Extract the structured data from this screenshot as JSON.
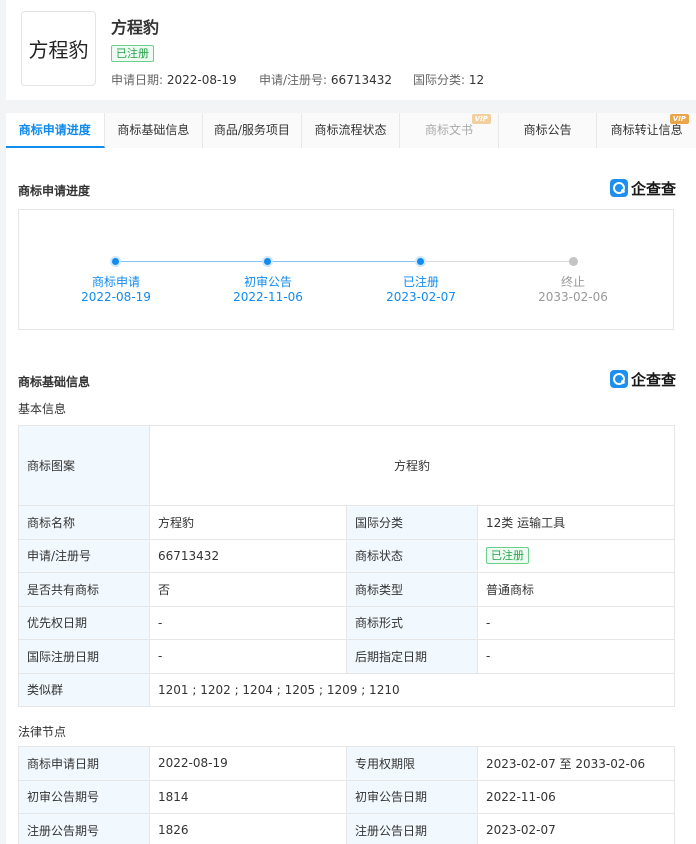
{
  "header": {
    "logo_text": "方程豹",
    "title": "方程豹",
    "status_badge": "已注册",
    "apply_date_label": "申请日期:",
    "apply_date": "2022-08-19",
    "reg_no_label": "申请/注册号:",
    "reg_no": "66713432",
    "intl_class_label": "国际分类:",
    "intl_class": "12"
  },
  "tabs": [
    {
      "label": "商标申请进度",
      "state": "active"
    },
    {
      "label": "商标基础信息",
      "state": "normal"
    },
    {
      "label": "商品/服务项目",
      "state": "normal"
    },
    {
      "label": "商标流程状态",
      "state": "normal"
    },
    {
      "label": "商标文书",
      "state": "disabled",
      "vip": "VIP"
    },
    {
      "label": "商标公告",
      "state": "normal"
    },
    {
      "label": "商标转让信息",
      "state": "normal",
      "vip": "VIP"
    }
  ],
  "progress": {
    "title": "商标申请进度",
    "brand": "企查查",
    "steps": [
      {
        "name": "商标申请",
        "date": "2022-08-19",
        "done": true
      },
      {
        "name": "初审公告",
        "date": "2022-11-06",
        "done": true
      },
      {
        "name": "已注册",
        "date": "2023-02-07",
        "done": true
      },
      {
        "name": "终止",
        "date": "2033-02-06",
        "done": false
      }
    ]
  },
  "basic": {
    "title": "商标基础信息",
    "brand": "企查查",
    "subtitle": "基本信息",
    "image_label": "商标图案",
    "image_text": "方程豹",
    "rows": [
      {
        "k1": "商标名称",
        "v1": "方程豹",
        "k2": "国际分类",
        "v2": "12类 运输工具"
      },
      {
        "k1": "申请/注册号",
        "v1": "66713432",
        "k2": "商标状态",
        "v2": "已注册"
      },
      {
        "k1": "是否共有商标",
        "v1": "否",
        "k2": "商标类型",
        "v2": "普通商标"
      },
      {
        "k1": "优先权日期",
        "v1": "-",
        "k2": "商标形式",
        "v2": "-"
      },
      {
        "k1": "国际注册日期",
        "v1": "-",
        "k2": "后期指定日期",
        "v2": "-"
      }
    ],
    "similar_label": "类似群",
    "similar_value": "1201 ; 1202 ; 1204 ; 1205 ; 1209 ; 1210"
  },
  "legal": {
    "subtitle": "法律节点",
    "rows": [
      {
        "k1": "商标申请日期",
        "v1": "2022-08-19",
        "k2": "专用权期限",
        "v2": "2023-02-07 至 2033-02-06"
      },
      {
        "k1": "初审公告期号",
        "v1": "1814",
        "k2": "初审公告日期",
        "v2": "2022-11-06"
      },
      {
        "k1": "注册公告期号",
        "v1": "1826",
        "k2": "注册公告日期",
        "v2": "2023-02-07"
      }
    ]
  },
  "colors": {
    "accent": "#128bed",
    "success": "#27a24a",
    "vip": "#e9a54a",
    "key_cell_bg": "#f2f9fe"
  }
}
